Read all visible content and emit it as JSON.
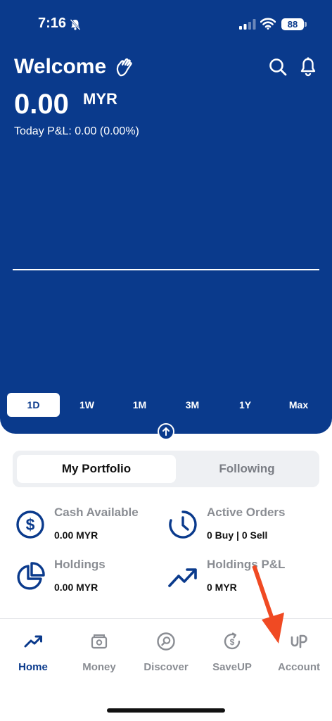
{
  "status_bar": {
    "time": "7:16",
    "battery": "88"
  },
  "header": {
    "greeting": "Welcome",
    "balance": "0.00",
    "currency": "MYR",
    "pnl": "Today P&L: 0.00 (0.00%)"
  },
  "range_tabs": [
    "1D",
    "1W",
    "1M",
    "3M",
    "1Y",
    "Max"
  ],
  "portfolio_tabs": {
    "active": "My Portfolio",
    "inactive": "Following"
  },
  "stats": {
    "cash": {
      "label": "Cash Available",
      "value": "0.00 MYR"
    },
    "orders": {
      "label": "Active Orders",
      "value": "0 Buy | 0 Sell"
    },
    "holdings": {
      "label": "Holdings",
      "value": "0.00 MYR"
    },
    "holdings_pnl": {
      "label": "Holdings P&L",
      "value": "0 MYR"
    }
  },
  "nav": [
    {
      "label": "Home",
      "icon": "trend-up-icon"
    },
    {
      "label": "Money",
      "icon": "wallet-icon"
    },
    {
      "label": "Discover",
      "icon": "discover-icon"
    },
    {
      "label": "SaveUP",
      "icon": "saveup-icon"
    },
    {
      "label": "Account",
      "icon": "account-icon"
    }
  ],
  "colors": {
    "brand": "#0a3a8c",
    "annotation_arrow": "#f04a23"
  }
}
